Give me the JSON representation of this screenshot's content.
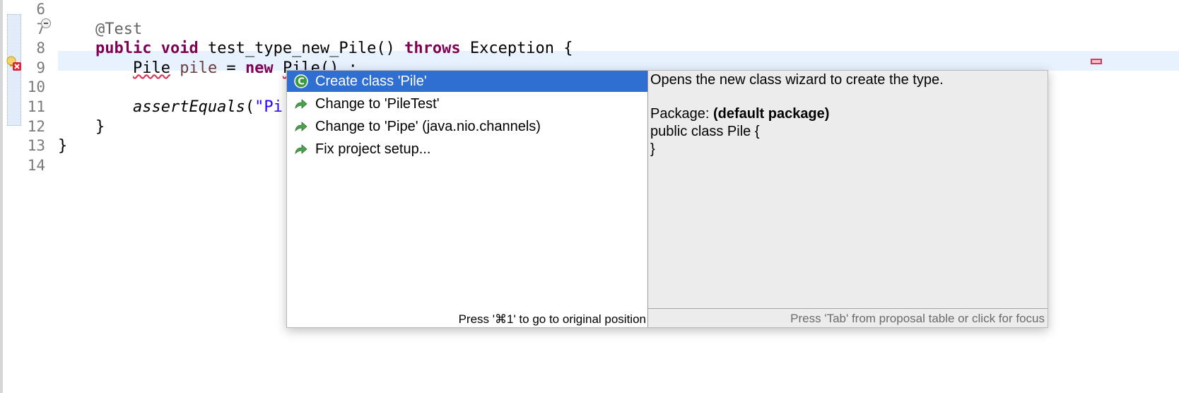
{
  "editor": {
    "line_numbers": [
      "6",
      "7",
      "8",
      "9",
      "10",
      "11",
      "12",
      "13",
      "14"
    ],
    "lines": {
      "l7_annotation": "@Test",
      "l8_kw_public": "public",
      "l8_kw_void": "void",
      "l8_method": " test_type_new_Pile() ",
      "l8_kw_throws": "throws",
      "l8_rest": " Exception {",
      "l9_type": "Pile",
      "l9_sp1": " ",
      "l9_var": "pile",
      "l9_assign": " = ",
      "l9_kw_new": "new",
      "l9_sp2": " ",
      "l9_ctor": "Pile",
      "l9_rest": "() ;",
      "l11_method": "assertEquals",
      "l11_paren": "(",
      "l11_str": "\"Pi",
      "l12_brace": "}",
      "l13_brace": "}"
    }
  },
  "quick_fix": {
    "proposals": [
      {
        "label": "Create class 'Pile'",
        "icon": "class-icon",
        "selected": true
      },
      {
        "label": "Change to 'PileTest'",
        "icon": "rename-arrow-icon",
        "selected": false
      },
      {
        "label": "Change to 'Pipe' (java.nio.channels)",
        "icon": "rename-arrow-icon",
        "selected": false
      },
      {
        "label": "Fix project setup...",
        "icon": "rename-arrow-icon",
        "selected": false
      }
    ],
    "left_hint": "Press '⌘1' to go to original position",
    "details": {
      "description": "Opens the new class wizard to create the type.",
      "package_label": "Package: ",
      "package_value": "(default package)",
      "source_line1": "public class Pile {",
      "source_line2": "}"
    },
    "right_hint": "Press 'Tab' from proposal table or click for focus"
  },
  "colors": {
    "keyword": "#7f0055",
    "string": "#2a00ff",
    "selection": "#2f6fd1",
    "error_underline": "#e0325a",
    "current_line": "#e8f2fe"
  }
}
